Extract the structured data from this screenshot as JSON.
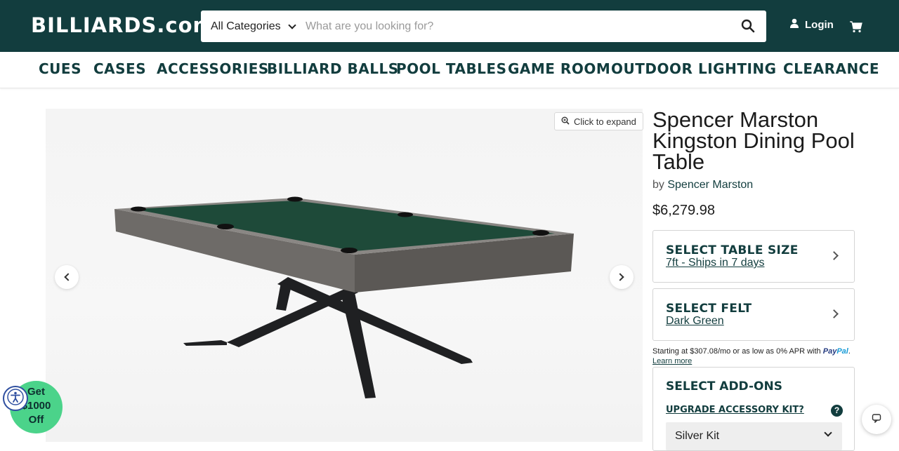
{
  "header": {
    "logo": "BILLIARDS.com",
    "category_select": "All Categories",
    "search_placeholder": "What are you looking for?",
    "login_label": "Login",
    "colors": {
      "brand_dark": "#123d3e",
      "promo_green": "#4bd38a"
    }
  },
  "nav": {
    "items": [
      "CUES",
      "CASES",
      "ACCESSORIES",
      "BILLIARD BALLS",
      "POOL TABLES",
      "GAME ROOM",
      "OUTDOOR",
      "LIGHTING",
      "CLEARANCE"
    ]
  },
  "gallery": {
    "expand_label": "Click to expand",
    "image_alt_icon": "pool-table-image"
  },
  "product": {
    "title": "Spencer Marston Kingston Dining Pool Table",
    "by_prefix": "by",
    "brand": "Spencer Marston",
    "price": "$6,279.98",
    "table_size_title": "SELECT TABLE SIZE",
    "table_size_value": "7ft - Ships in 7 days",
    "felt_title": "SELECT FELT",
    "felt_value": "Dark Green"
  },
  "paypal": {
    "text": "Starting at $307.08/mo or as low as 0% APR with",
    "brand_a": "Pay",
    "brand_b": "Pal",
    "learn_more": "Learn more"
  },
  "addons": {
    "title": "SELECT ADD-ONS",
    "upgrade_label": "UPGRADE ACCESSORY KIT?",
    "help_glyph": "?",
    "kit_selected": "Silver Kit"
  },
  "promo": {
    "line1": "Get",
    "line2": "$1000",
    "line3": "Off"
  }
}
